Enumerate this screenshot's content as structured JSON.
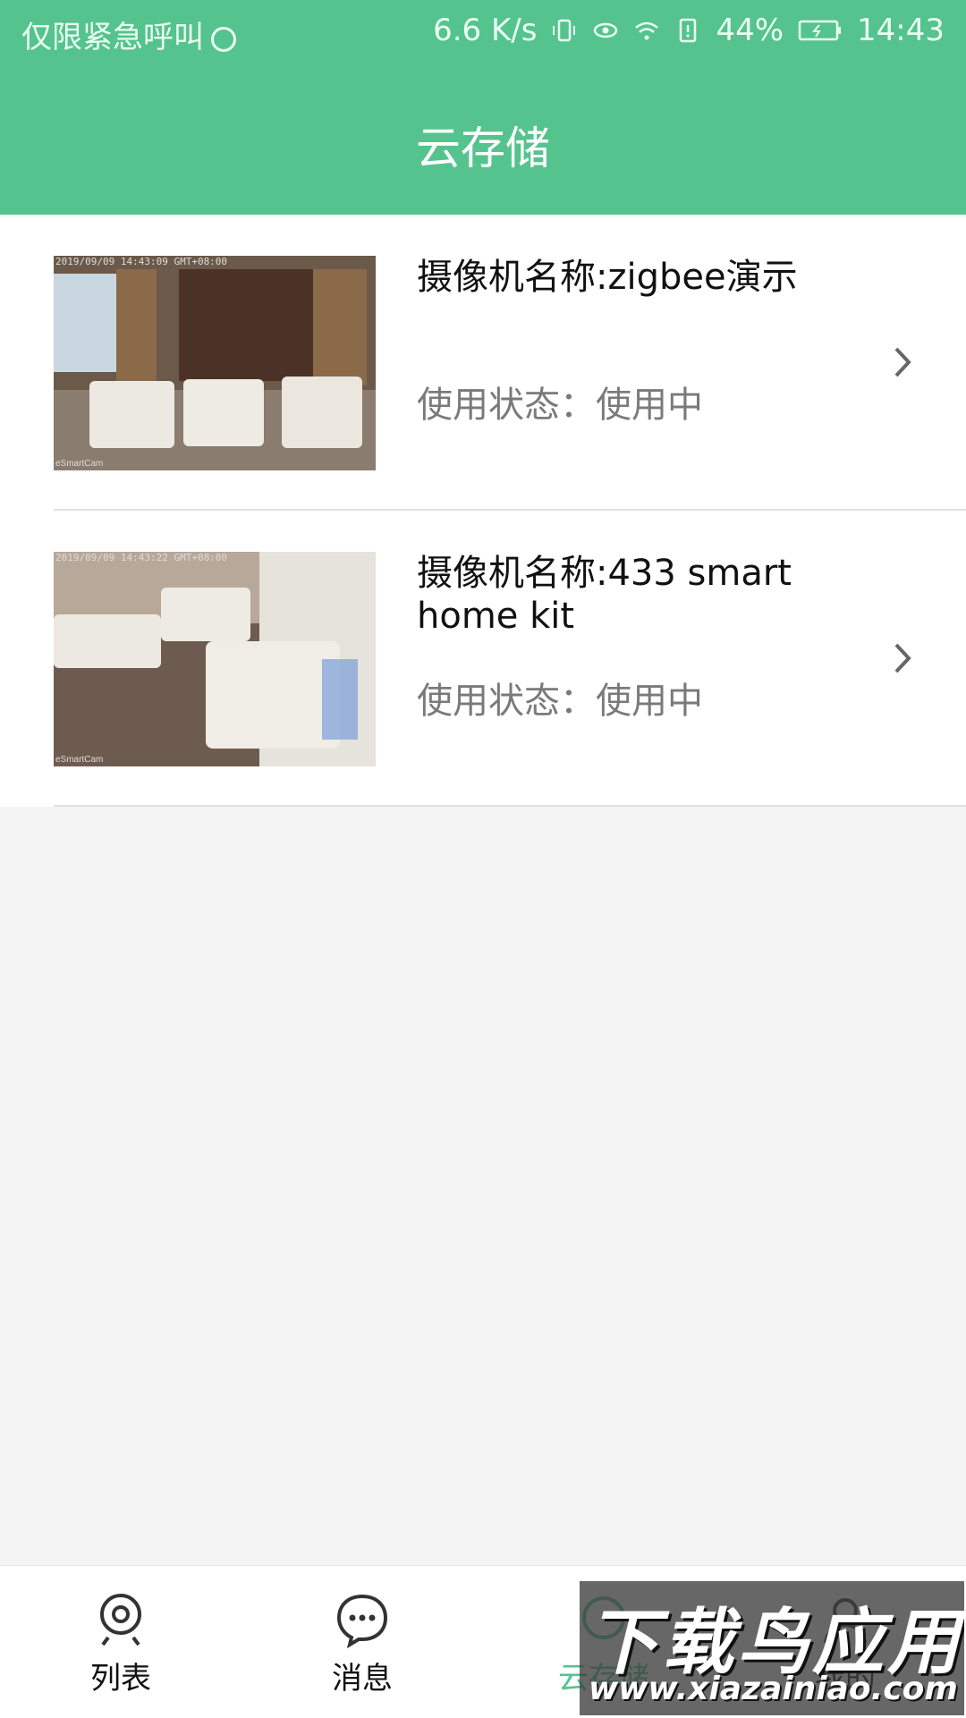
{
  "status_bar": {
    "carrier": "仅限紧急呼叫",
    "net_speed": "6.6 K/s",
    "battery_percent": "44%",
    "time": "14:43"
  },
  "header": {
    "title": "云存储"
  },
  "cameras": [
    {
      "name": "摄像机名称:zigbee演示",
      "status": "使用状态：使用中",
      "timestamp": "2019/09/09 14:43:09 GMT+08:00",
      "brand": "eSmartCam"
    },
    {
      "name": "摄像机名称:433 smart home kit",
      "status": "使用状态：使用中",
      "timestamp": "2019/09/09 14:43:22 GMT+08:00",
      "brand": "eSmartCam"
    }
  ],
  "tabs": [
    {
      "label": "列表",
      "icon": "camera-icon"
    },
    {
      "label": "消息",
      "icon": "message-icon"
    },
    {
      "label": "云存储",
      "icon": "cloud-icon",
      "active": true
    },
    {
      "label": "我的",
      "icon": "person-icon"
    }
  ],
  "watermark": {
    "title": "下载鸟应用",
    "url": "www.xiazainiao.com"
  },
  "colors": {
    "accent": "#55c38d",
    "text": "#111111",
    "secondary": "#7a7a7a"
  }
}
